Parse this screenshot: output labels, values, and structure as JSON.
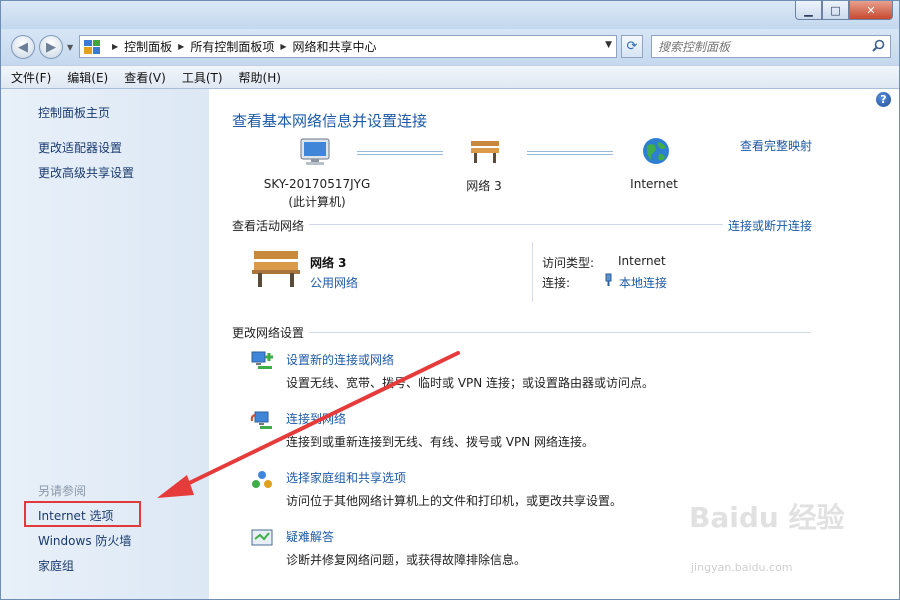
{
  "window": {
    "controls": {
      "minimize": "▁",
      "maximize": "□",
      "close": "✕"
    }
  },
  "navbar": {
    "breadcrumbs": [
      "控制面板",
      "所有控制面板项",
      "网络和共享中心"
    ],
    "search_placeholder": "搜索控制面板"
  },
  "menubar": {
    "items": [
      "文件(F)",
      "编辑(E)",
      "查看(V)",
      "工具(T)",
      "帮助(H)"
    ]
  },
  "left": {
    "links": [
      "控制面板主页",
      "更改适配器设置",
      "更改高级共享设置"
    ],
    "see_also": "另请参阅",
    "see_also_links": [
      "Internet 选项",
      "Windows 防火墙",
      "家庭组"
    ]
  },
  "main": {
    "title": "查看基本网络信息并设置连接",
    "map_link": "查看完整映射",
    "nodes": {
      "computer_name": "SKY-20170517JYG",
      "computer_sub": "(此计算机)",
      "network": "网络  3",
      "internet": "Internet"
    },
    "active_network": {
      "section_title": "查看活动网络",
      "connect_link": "连接或断开连接",
      "name": "网络  3",
      "type": "公用网络",
      "access_type_label": "访问类型:",
      "access_type_value": "Internet",
      "connections_label": "连接:",
      "connections_value": "本地连接"
    },
    "change_settings": {
      "section_title": "更改网络设置",
      "tasks": [
        {
          "title": "设置新的连接或网络",
          "desc": "设置无线、宽带、拨号、临时或 VPN 连接；或设置路由器或访问点。"
        },
        {
          "title": "连接到网络",
          "desc": "连接到或重新连接到无线、有线、拨号或 VPN 网络连接。"
        },
        {
          "title": "选择家庭组和共享选项",
          "desc": "访问位于其他网络计算机上的文件和打印机，或更改共享设置。"
        },
        {
          "title": "疑难解答",
          "desc": "诊断并修复网络问题，或获得故障排除信息。"
        }
      ]
    }
  },
  "watermark": {
    "brand": "Baidu 经验",
    "url": "jingyan.baidu.com"
  }
}
